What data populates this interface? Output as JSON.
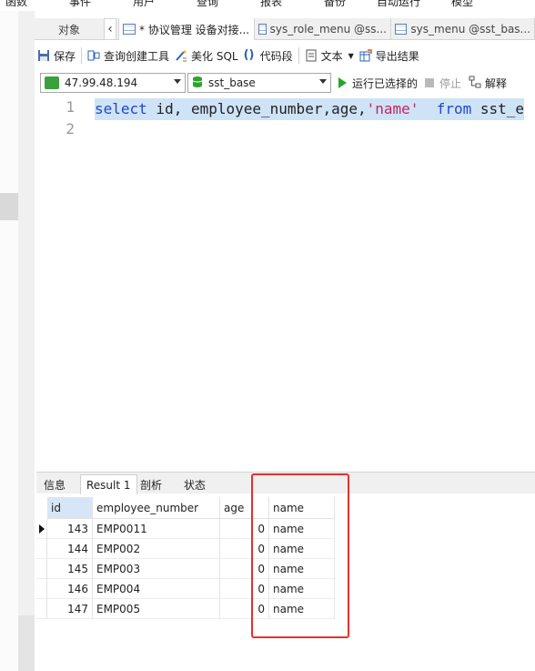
{
  "menu": [
    "函数",
    "事件",
    "用户",
    "查询",
    "报表",
    "备份",
    "自动运行",
    "模型"
  ],
  "tabs": {
    "objects": "对象",
    "items": [
      "* 协议管理 设备对接...",
      "sys_role_menu @ss...",
      "sys_menu @sst_bas..."
    ]
  },
  "toolbar": {
    "save": "保存",
    "query_builder": "查询创建工具",
    "beautify": "美化 SQL",
    "snippet": "代码段",
    "text": "文本",
    "export": "导出结果"
  },
  "connection": {
    "host": "47.99.48.194",
    "database": "sst_base",
    "run_selected": "运行已选择的",
    "stop": "停止",
    "explain": "解释"
  },
  "editor": {
    "line_numbers": [
      "1",
      "2"
    ],
    "tokens": {
      "select": "select",
      "cols": " id, employee_number,age,",
      "literal": "'name'",
      "gap": "  ",
      "from": "from",
      "rest": " sst_e"
    }
  },
  "result_tabs": [
    "信息",
    "Result 1",
    "剖析",
    "状态"
  ],
  "result": {
    "columns": [
      "id",
      "employee_number",
      "age",
      "name"
    ],
    "rows": [
      [
        "143",
        "EMP0011",
        "0",
        "name"
      ],
      [
        "144",
        "EMP002",
        "0",
        "name"
      ],
      [
        "145",
        "EMP003",
        "0",
        "name"
      ],
      [
        "146",
        "EMP004",
        "0",
        "name"
      ],
      [
        "147",
        "EMP005",
        "0",
        "name"
      ]
    ]
  },
  "colors": {
    "keyword": "#1f45d6",
    "string": "#c4265d",
    "highlight": "#cfe3f7",
    "annotation": "#e8302c",
    "run": "#2aa52a"
  }
}
